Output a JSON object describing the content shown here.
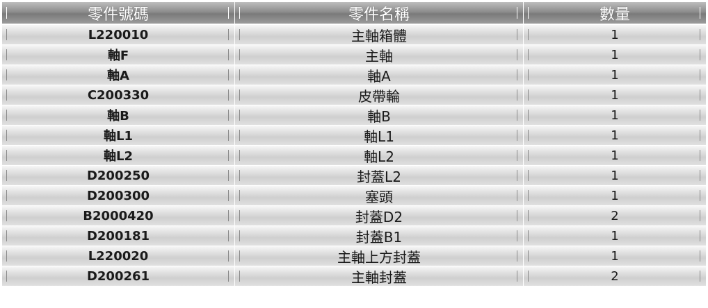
{
  "table": {
    "headers": [
      "零件號碼",
      "零件名稱",
      "數量"
    ],
    "rows": [
      [
        "L220010",
        "主軸箱體",
        "1"
      ],
      [
        "軸F",
        "主軸",
        "1"
      ],
      [
        "軸A",
        "軸A",
        "1"
      ],
      [
        "C200330",
        "皮帶輪",
        "1"
      ],
      [
        "軸B",
        "軸B",
        "1"
      ],
      [
        "軸L1",
        "軸L1",
        "1"
      ],
      [
        "軸L2",
        "軸L2",
        "1"
      ],
      [
        "D200250",
        "封蓋L2",
        "1"
      ],
      [
        "D200300",
        "塞頭",
        "1"
      ],
      [
        "B2000420",
        "封蓋D2",
        "2"
      ],
      [
        "D200181",
        "封蓋B1",
        "1"
      ],
      [
        "L220020",
        "主軸上方封蓋",
        "1"
      ],
      [
        "D200261",
        "主軸封蓋",
        "2"
      ]
    ]
  },
  "colors": {
    "header_bg": "#8d8d8d",
    "header_text": "#ffffff",
    "row_bg": "#dcdcdc",
    "row_text": "#1a1a1a",
    "grid_line": "#ffffff"
  }
}
